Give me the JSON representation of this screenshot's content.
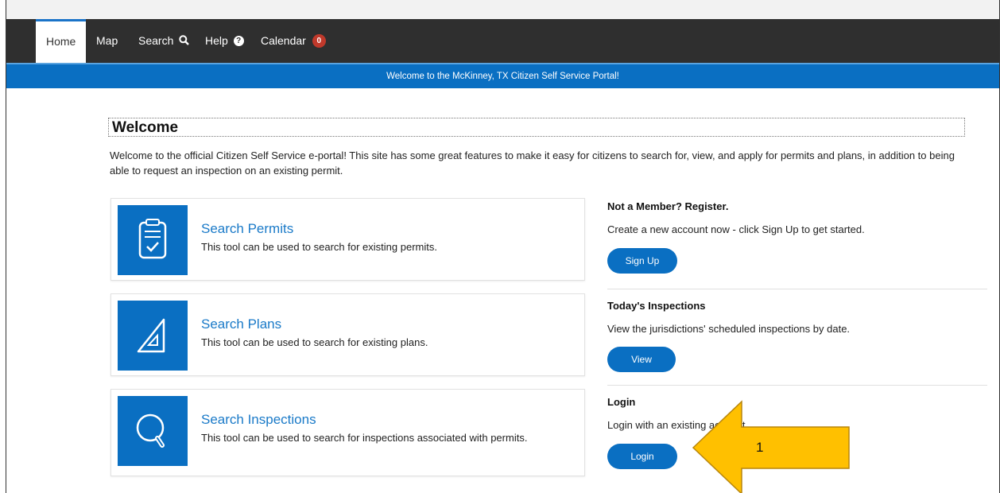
{
  "nav": {
    "home": "Home",
    "map": "Map",
    "search": "Search",
    "help": "Help",
    "calendar": "Calendar",
    "calendar_count": "0"
  },
  "banner": "Welcome to the McKinney, TX Citizen Self Service Portal!",
  "welcome": {
    "title": "Welcome",
    "intro": "Welcome to the official Citizen Self Service e-portal! This site has some great features to make it easy for citizens to search for, view, and apply for permits and plans, in addition to being able to request an inspection on an existing permit."
  },
  "cards": [
    {
      "title": "Search Permits",
      "desc": "This tool can be used to search for existing permits.",
      "icon": "clipboard-check-icon"
    },
    {
      "title": "Search Plans",
      "desc": "This tool can be used to search for existing plans.",
      "icon": "triangle-ruler-icon"
    },
    {
      "title": "Search Inspections",
      "desc": "This tool can be used to search for inspections associated with permits.",
      "icon": "magnifier-icon"
    }
  ],
  "side": {
    "register": {
      "title": "Not a Member? Register.",
      "text": "Create a new account now - click Sign Up to get started.",
      "button": "Sign Up"
    },
    "inspections": {
      "title": "Today's Inspections",
      "text": "View the jurisdictions' scheduled inspections by date.",
      "button": "View"
    },
    "login": {
      "title": "Login",
      "text": "Login with an existing account.",
      "button": "Login"
    }
  },
  "annotation": {
    "label": "1"
  },
  "colors": {
    "navbar": "#2f2f2f",
    "primary": "#0a6fc2",
    "link": "#1a7ac8",
    "badge": "#c0392b",
    "arrow": "#ffc000"
  }
}
